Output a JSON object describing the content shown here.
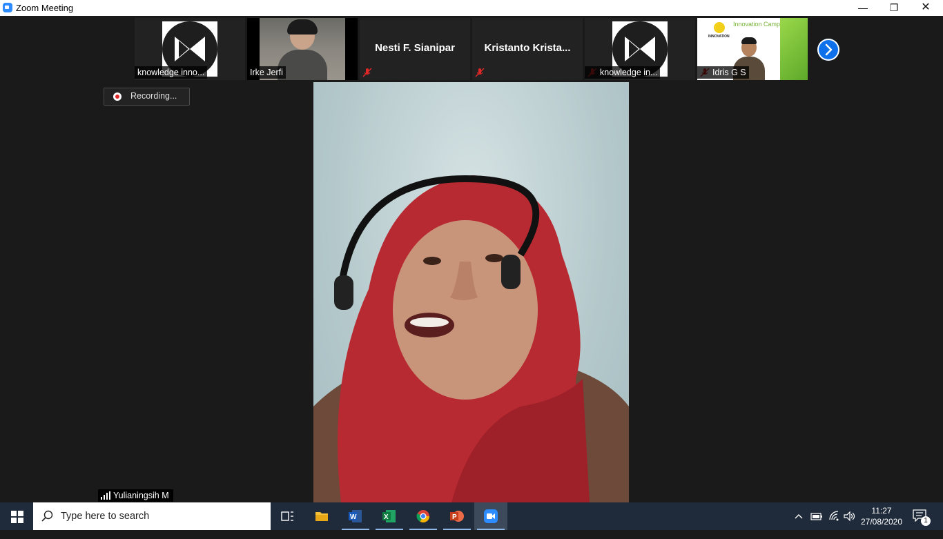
{
  "window": {
    "title": "Zoom Meeting",
    "minimize_glyph": "—",
    "restore_glyph": "❐",
    "close_glyph": "✕"
  },
  "thumbnails": [
    {
      "name": "knowledge inno...",
      "video": "off",
      "muted": false
    },
    {
      "name": "Irke Jerfi",
      "video": "on",
      "muted": false
    },
    {
      "name": "Nesti F. Sianipar",
      "video": "none",
      "muted": true
    },
    {
      "name": "Kristanto  Krista...",
      "video": "none",
      "muted": true
    },
    {
      "name": "knowledge in...",
      "video": "off",
      "muted": true
    },
    {
      "name": "Idris G S",
      "video": "on",
      "muted": true,
      "slide_title": "Innovation Camp",
      "slide_logo": "INNOVATION"
    }
  ],
  "recording": {
    "label": "Recording..."
  },
  "main_speaker": {
    "name": "Yulianingsih M"
  },
  "taskbar": {
    "search_placeholder": "Type here to search",
    "apps": [
      "task-view",
      "file-explorer",
      "word",
      "excel",
      "chrome",
      "powerpoint",
      "zoom"
    ],
    "clock_time": "11:27",
    "clock_date": "27/08/2020",
    "notification_count": "1"
  },
  "colors": {
    "accent": "#2d8cff",
    "zoom_blue": "#0e71eb",
    "recording_red": "#e02828",
    "taskbar": "#1f2b3a",
    "muted_red": "#e02828"
  }
}
